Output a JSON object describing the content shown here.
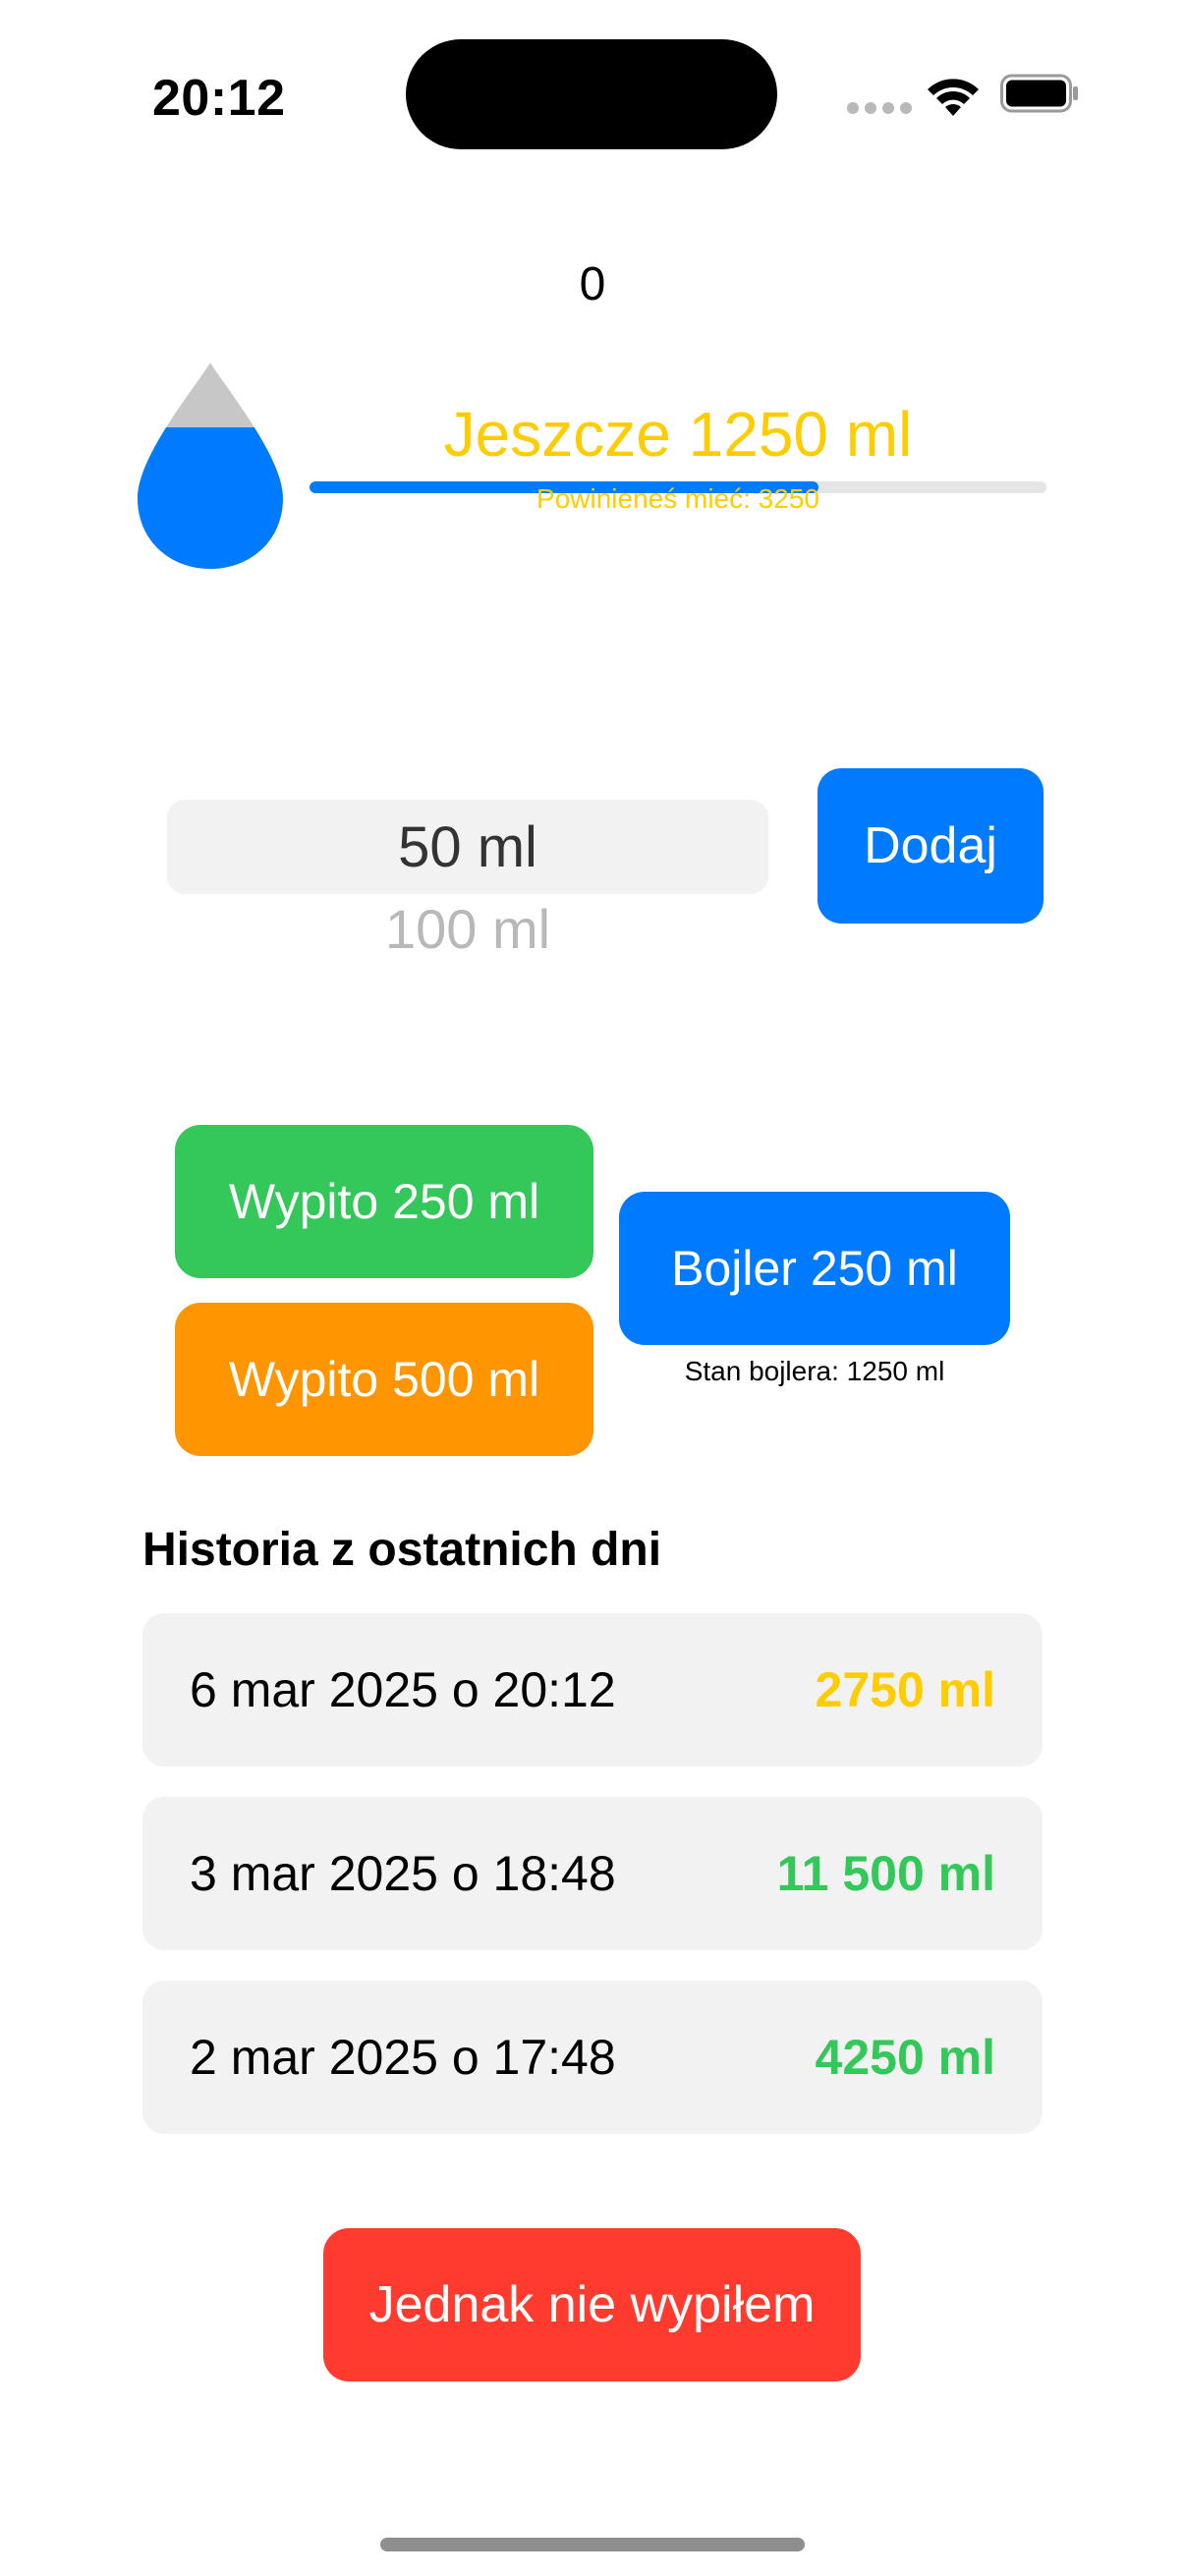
{
  "status_bar": {
    "time": "20:12"
  },
  "counter": {
    "value": "0"
  },
  "progress": {
    "remaining_text": "Jeszcze 1250 ml",
    "goal_text": "Powinieneś mieć: 3250",
    "fill_fraction": 0.69,
    "fill_color": "#007aff",
    "text_color": "#ffcc00"
  },
  "drop_icon": {
    "name": "water-drop-icon",
    "fill_color": "#007aff",
    "empty_color": "#c7c7c7"
  },
  "picker": {
    "selected": "50 ml",
    "next": "100 ml"
  },
  "add_button": {
    "label": "Dodaj"
  },
  "quick_buttons": {
    "drank_250": "Wypito 250 ml",
    "drank_500": "Wypito 500 ml",
    "boiler": "Bojler 250 ml",
    "boiler_state": "Stan bojlera: 1250 ml"
  },
  "history": {
    "title": "Historia z ostatnich dni",
    "items": [
      {
        "date": "6 mar 2025 o 20:12",
        "amount": "2750 ml",
        "color": "#ffcc00"
      },
      {
        "date": "3 mar 2025 o 18:48",
        "amount": "11 500 ml",
        "color": "#34c759"
      },
      {
        "date": "2 mar 2025 o 17:48",
        "amount": "4250 ml",
        "color": "#34c759"
      }
    ]
  },
  "undo_button": {
    "label": "Jednak nie wypiłem"
  },
  "colors": {
    "blue": "#007aff",
    "green": "#34c759",
    "orange": "#ff9500",
    "red": "#ff3b30",
    "yellow": "#ffcc00"
  }
}
